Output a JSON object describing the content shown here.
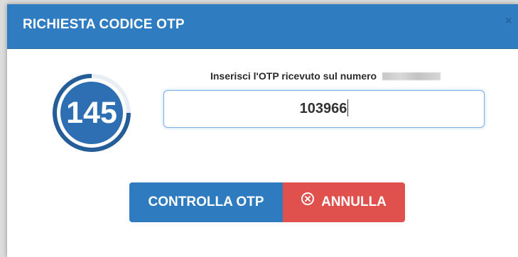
{
  "dialog": {
    "title": "RICHIESTA CODICE OTP",
    "close_symbol": "×",
    "header_color": "#2f7cc1"
  },
  "timer": {
    "value": "145",
    "fill_color": "#2e6fb3",
    "ring_color": "#245d98"
  },
  "otp": {
    "prompt": "Inserisci l'OTP ricevuto sul numero",
    "phone_masked": true,
    "input_value": "103966"
  },
  "actions": {
    "check_label": "CONTROLLA OTP",
    "cancel_label": "ANNULLA",
    "check_color": "#2e7bc0",
    "cancel_color": "#e0504d"
  }
}
